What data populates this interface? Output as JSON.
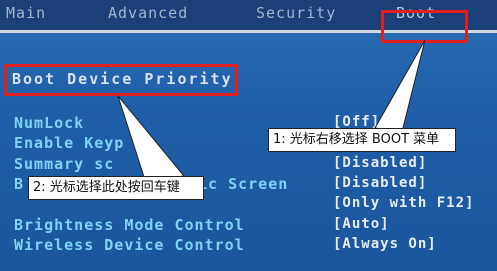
{
  "tabs": [
    "Main",
    "Advanced",
    "Security",
    "Boot"
  ],
  "section_title": "Boot Device Priority",
  "items": [
    {
      "label": "NumLock",
      "value": "[Off]"
    },
    {
      "label": "Enable Keyp",
      "value": ""
    },
    {
      "label": "Summary sc",
      "value": "[Disabled]"
    },
    {
      "label": "B",
      "value": "[Disabled]",
      "fragment": "ic Screen"
    },
    {
      "label": "",
      "value": "[Only with F12]"
    },
    {
      "label": "Brightness Mode Control",
      "value": "[Auto]"
    },
    {
      "label": "Wireless Device Control",
      "value": "[Always On]"
    }
  ],
  "callouts": {
    "boot": "1: 光标右移选择 BOOT 菜单",
    "enter": "2: 光标选择此处按回车键"
  },
  "colors": {
    "highlight": "#e0201c",
    "label": "#7fd3f5",
    "value": "#e6ecf2"
  }
}
